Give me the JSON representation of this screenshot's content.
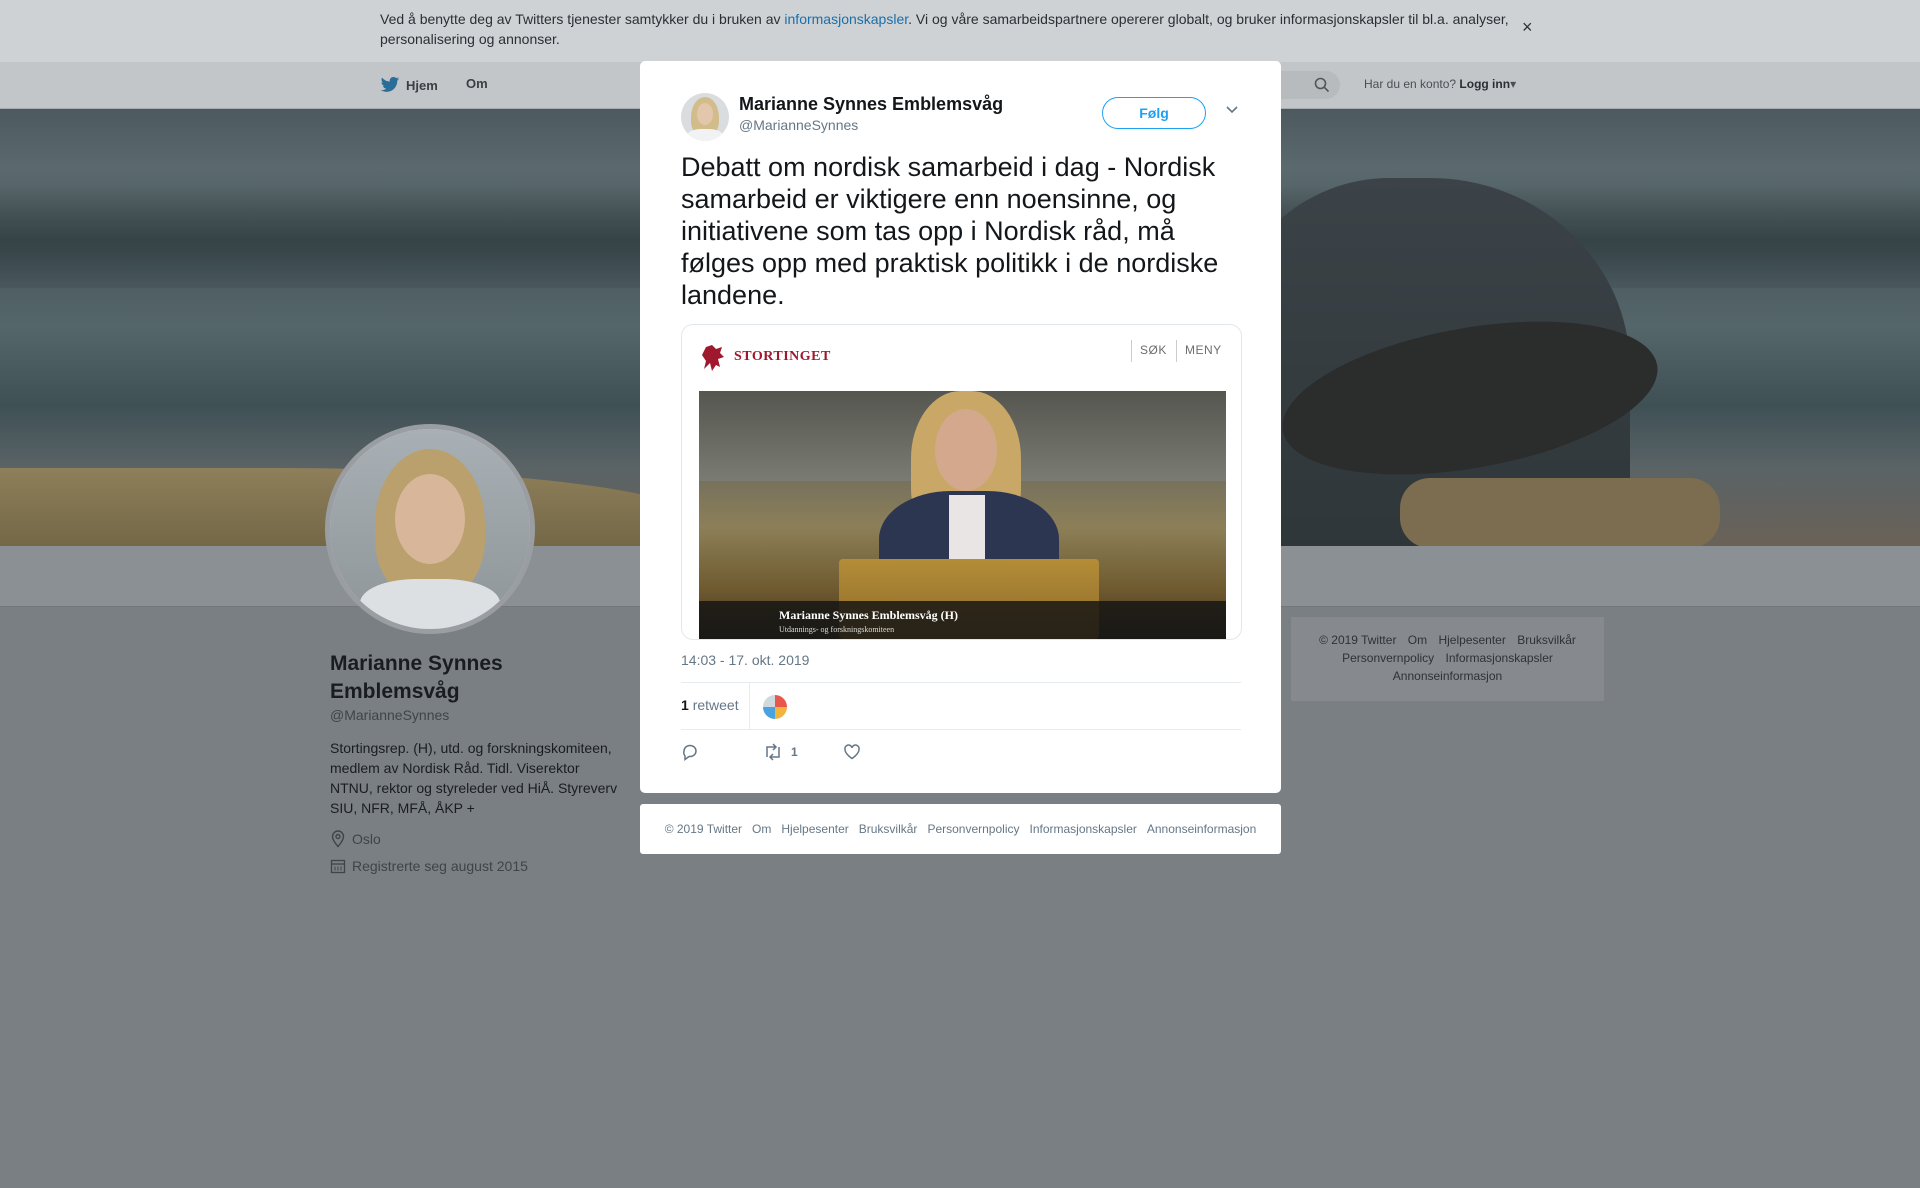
{
  "cookie_bar": {
    "text_before": "Ved å benytte deg av Twitters tjenester samtykker du i bruken av ",
    "link": "informasjonskapsler",
    "text_after": ". Vi og våre samarbeidspartnere opererer globalt, og bruker informasjonskapsler til bl.a. analyser, personalisering og annonser.",
    "close": "×"
  },
  "nav": {
    "home": "Hjem",
    "about": "Om",
    "account_prompt": "Har du en konto?",
    "login": "Logg inn"
  },
  "profile": {
    "name": "Marianne Synnes Emblemsvåg",
    "handle": "@MarianneSynnes",
    "bio": "Stortingsrep. (H), utd. og forskningskomiteen, medlem av Nordisk Råd. Tidl. Viserektor NTNU, rektor og styreleder ved HiÅ. Styreverv SIU, NFR, MFÅ, ÅKP +",
    "location": "Oslo",
    "joined": "Registrerte seg august 2015"
  },
  "side_footer": [
    "© 2019 Twitter",
    "Om",
    "Hjelpesenter",
    "Bruksvilkår",
    "Personvernpolicy",
    "Informasjonskapsler",
    "Annonseinformasjon"
  ],
  "tweet": {
    "author_name": "Marianne Synnes Emblemsvåg",
    "author_handle": "@MarianneSynnes",
    "follow": "Følg",
    "text": "Debatt om nordisk samarbeid i dag - Nordisk samarbeid er viktigere enn noensinne, og initiativene som tas opp i Nordisk råd, må følges opp med praktisk politikk i de nordiske landene.",
    "card": {
      "logo_text": "STORTINGET",
      "search": "SØK",
      "menu": "MENY",
      "caption_title": "Marianne Synnes Emblemsvåg (H)",
      "caption_sub": "Utdannings- og forskningskomiteen"
    },
    "timestamp": "14:03 - 17. okt. 2019",
    "retweet_count": "1",
    "retweet_label": "retweet",
    "action_retweet_count": "1"
  },
  "modal_footer": [
    "© 2019 Twitter",
    "Om",
    "Hjelpesenter",
    "Bruksvilkår",
    "Personvernpolicy",
    "Informasjonskapsler",
    "Annonseinformasjon"
  ],
  "page_close": "✕",
  "colors": {
    "twitter_blue": "#1da1f2",
    "stortinget_red": "#a0182d",
    "overlay": "#7a7f84"
  },
  "icons": [
    "twitter-bird-icon",
    "search-icon",
    "caret-down-icon",
    "location-pin-icon",
    "calendar-icon",
    "reply-icon",
    "retweet-icon",
    "like-icon",
    "stortinget-lion-icon",
    "close-icon"
  ]
}
